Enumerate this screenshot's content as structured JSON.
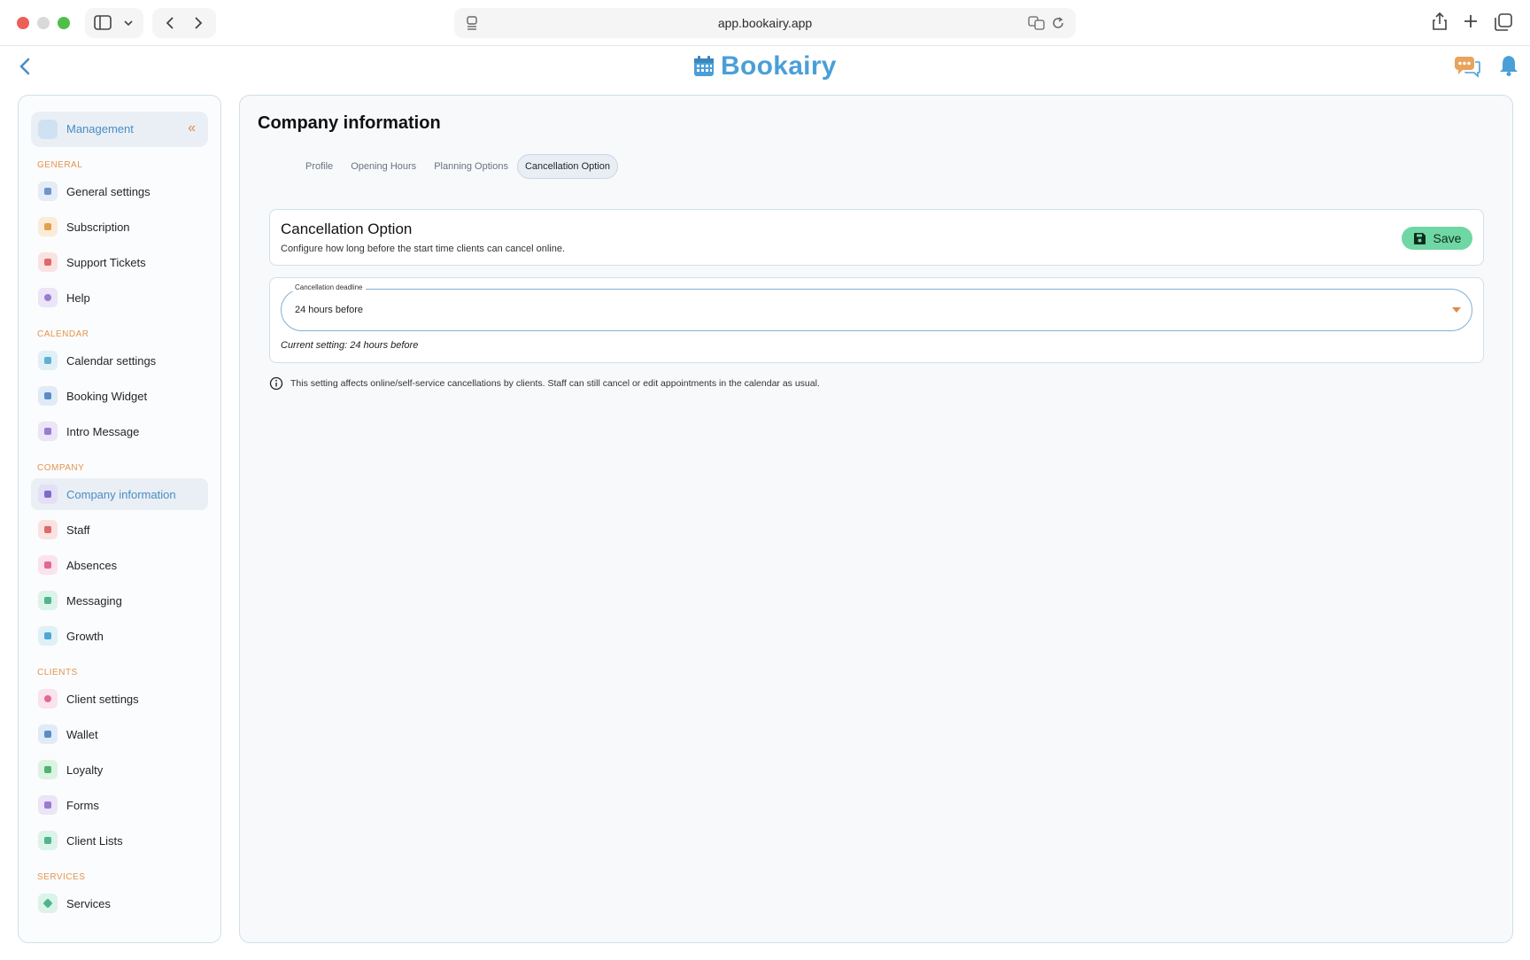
{
  "browser": {
    "url": "app.bookairy.app"
  },
  "header": {
    "brand": "Bookairy"
  },
  "sidebar": {
    "management_label": "Management",
    "sections": {
      "general": "GENERAL",
      "calendar": "CALENDAR",
      "company": "COMPANY",
      "clients": "CLIENTS",
      "services": "SERVICES"
    },
    "items": {
      "general_settings": "General settings",
      "subscription": "Subscription",
      "support_tickets": "Support Tickets",
      "help": "Help",
      "calendar_settings": "Calendar settings",
      "booking_widget": "Booking Widget",
      "intro_message": "Intro Message",
      "company_information": "Company information",
      "staff": "Staff",
      "absences": "Absences",
      "messaging": "Messaging",
      "growth": "Growth",
      "client_settings": "Client settings",
      "wallet": "Wallet",
      "loyalty": "Loyalty",
      "forms": "Forms",
      "client_lists": "Client Lists",
      "services": "Services"
    },
    "active_item": "Company information"
  },
  "main": {
    "title": "Company information",
    "tabs": [
      "Profile",
      "Opening Hours",
      "Planning Options",
      "Cancellation Option"
    ],
    "active_tab": "Cancellation Option",
    "card": {
      "title": "Cancellation Option",
      "description": "Configure how long before the start time clients can cancel online.",
      "save_label": "Save"
    },
    "deadline": {
      "label": "Cancellation deadline",
      "value": "24 hours before",
      "current_setting": "Current setting: 24 hours before"
    },
    "info_text": "This setting affects online/self-service cancellations by clients. Staff can still cancel or edit appointments in the calendar as usual."
  },
  "colors": {
    "brand": "#4a9fd8",
    "accent_orange": "#e08a4a",
    "save_green": "#6fd7a3",
    "active_bg": "#e9eff5"
  }
}
